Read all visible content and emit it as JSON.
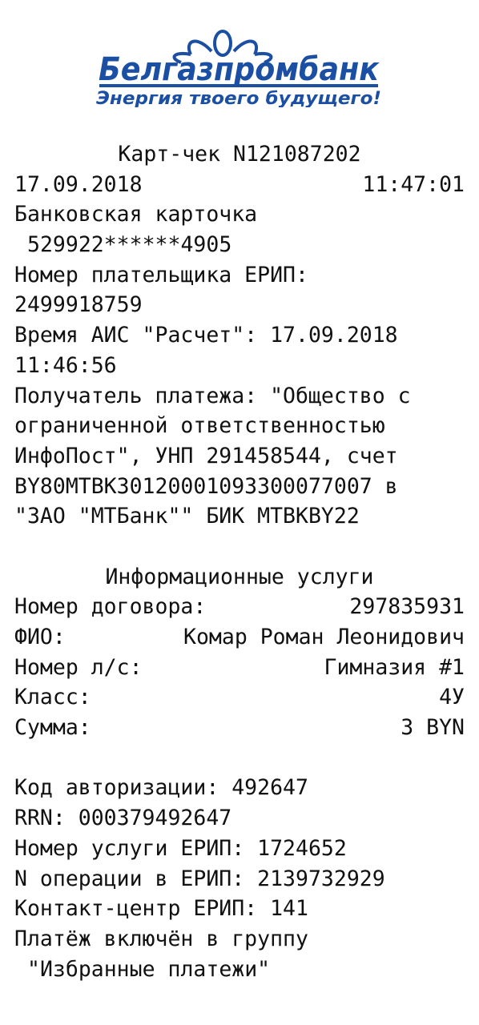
{
  "logo": {
    "brand_text": "Белгазпромбанк",
    "slogan": "Энергия твоего будущего!",
    "color": "#1b4fa3"
  },
  "receipt": {
    "header": "Карт-чек N121087202",
    "date": "17.09.2018",
    "time": "11:47:01",
    "card_label": "Банковская карточка",
    "card_number": "529922******4905",
    "payer_label": "Номер плательщика ЕРИП:",
    "payer_number": "2499918759",
    "ais_time_line": "Время АИС \"Расчет\": 17.09.2018",
    "ais_time_cont": "11:46:56",
    "recipient_lines": [
      "Получатель платежа: \"Общество с",
      "ограниченной ответственностью",
      "ИнфоПост\", УНП 291458544, счет",
      "BY80MTBK30120001093300077007 в",
      "\"ЗАО \"МТБанк\"\" БИК MTBKBY22"
    ],
    "service_title": "Информационные услуги",
    "details": [
      {
        "label": "Номер договора:",
        "value": "297835931"
      },
      {
        "label": "ФИО:",
        "value": "Комар Роман Леонидович"
      },
      {
        "label": "Номер л/с:",
        "value": "Гимназия #1"
      },
      {
        "label": "Класс:",
        "value": "4У"
      },
      {
        "label": "Сумма:",
        "value": "3 BYN"
      }
    ],
    "footer_lines": [
      "Код авторизации: 492647",
      "RRN: 000379492647",
      "Номер услуги ЕРИП: 1724652",
      "N операции в ЕРИП: 2139732929",
      "Контакт-центр ЕРИП: 141",
      "Платёж включён в группу"
    ],
    "favorites_line": "\"Избранные платежи\""
  }
}
